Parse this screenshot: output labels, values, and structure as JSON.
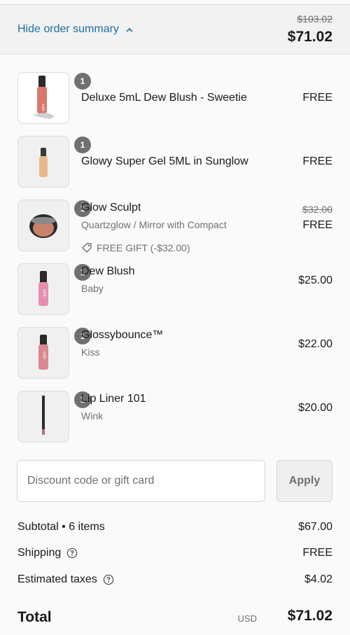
{
  "header": {
    "toggle_label": "Hide order summary",
    "original_total": "$103.02",
    "total": "$71.02",
    "link_color": "#1d6fa5"
  },
  "items": [
    {
      "qty": "1",
      "name": "Deluxe 5mL Dew Blush - Sweetie",
      "variant": "",
      "price": "FREE"
    },
    {
      "qty": "1",
      "name": "Glowy Super Gel 5ML in Sunglow",
      "variant": "",
      "price": "FREE"
    },
    {
      "qty": "1",
      "name": "Glow Sculpt",
      "variant": "Quartzglow / Mirror with Compact",
      "gift_label": "FREE GIFT (-$32.00)",
      "original_price": "$32.00",
      "price": "FREE"
    },
    {
      "qty": "1",
      "name": "Dew Blush",
      "variant": "Baby",
      "price": "$25.00"
    },
    {
      "qty": "1",
      "name": "Glossybounce™",
      "variant": "Kiss",
      "price": "$22.00"
    },
    {
      "qty": "1",
      "name": "Lip Liner 101",
      "variant": "Wink",
      "price": "$20.00"
    }
  ],
  "discount": {
    "placeholder": "Discount code or gift card",
    "apply_label": "Apply"
  },
  "summary": {
    "subtotal_label": "Subtotal • 6 items",
    "subtotal_value": "$67.00",
    "shipping_label": "Shipping",
    "shipping_value": "FREE",
    "taxes_label": "Estimated taxes",
    "taxes_value": "$4.02",
    "total_label": "Total",
    "currency": "USD",
    "total_value": "$71.02"
  },
  "icons": {
    "toggle": "chevron-up-icon",
    "gift": "tag-icon",
    "help": "question-circle-icon"
  }
}
